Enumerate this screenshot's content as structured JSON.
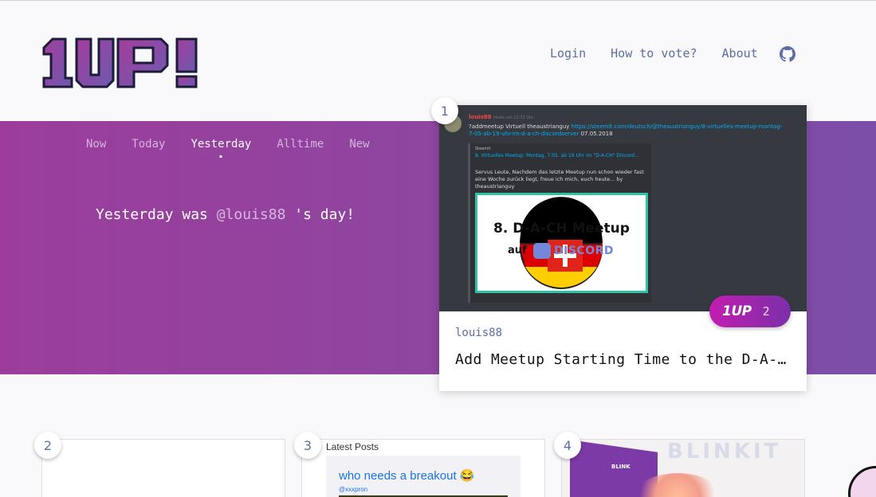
{
  "logo_text": "1UP!",
  "nav": {
    "login": "Login",
    "how_to_vote": "How to vote?",
    "about": "About"
  },
  "tabs": [
    "Now",
    "Today",
    "Yesterday",
    "Alltime",
    "New"
  ],
  "active_tab": "Yesterday",
  "day_message": {
    "prefix": "Yesterday was",
    "user": "@louis88",
    "suffix": " 's day!"
  },
  "featured": {
    "rank": "1",
    "author": "louis88",
    "title": "Add Meetup Starting Time to the D-A-CH Meetup",
    "badge_label": "1UP",
    "badge_count": "2",
    "thumb": {
      "username": "louis88",
      "timestamp": "heute um 22:31 Uhr",
      "message": "?addmeetup Virtuell theaustrianguy",
      "link": "https://steemit.com/deutsch/@theaustrianguy/8-virtuelles-meetup-montag-7-05-ab-19-uhr-im-d-a-ch-discordserver",
      "date": "07.05.2018",
      "embed_site": "Steemit",
      "embed_title": "8. Virtuelles Meetup: Montag, 7.05. ab 19 Uhr im \"D-A-CH\" Discord...",
      "embed_text": "Servus Leute,  Nachdem das letzte Meetup nun schon wieder fast eine Woche zurück liegt, freue ich mich, euch heute... by theaustrianguy",
      "image_line1": "8. D-A-CH Meetup",
      "image_line2": "auf",
      "image_line3": "DISCORD"
    }
  },
  "cards": [
    {
      "rank": "2"
    },
    {
      "rank": "3",
      "header": "Latest Posts",
      "post_title": "who needs a breakout 😂",
      "post_author": "@xxxpron"
    },
    {
      "rank": "4",
      "brand": "BLINKIT",
      "brand_small": "BLINK"
    }
  ],
  "colors": {
    "purple_band_start": "#9c3d9c",
    "purple_band_end": "#7c4ea8",
    "link_blue": "#5c6ea3",
    "badge_start": "#c21db1",
    "badge_end": "#7a2fa8"
  }
}
